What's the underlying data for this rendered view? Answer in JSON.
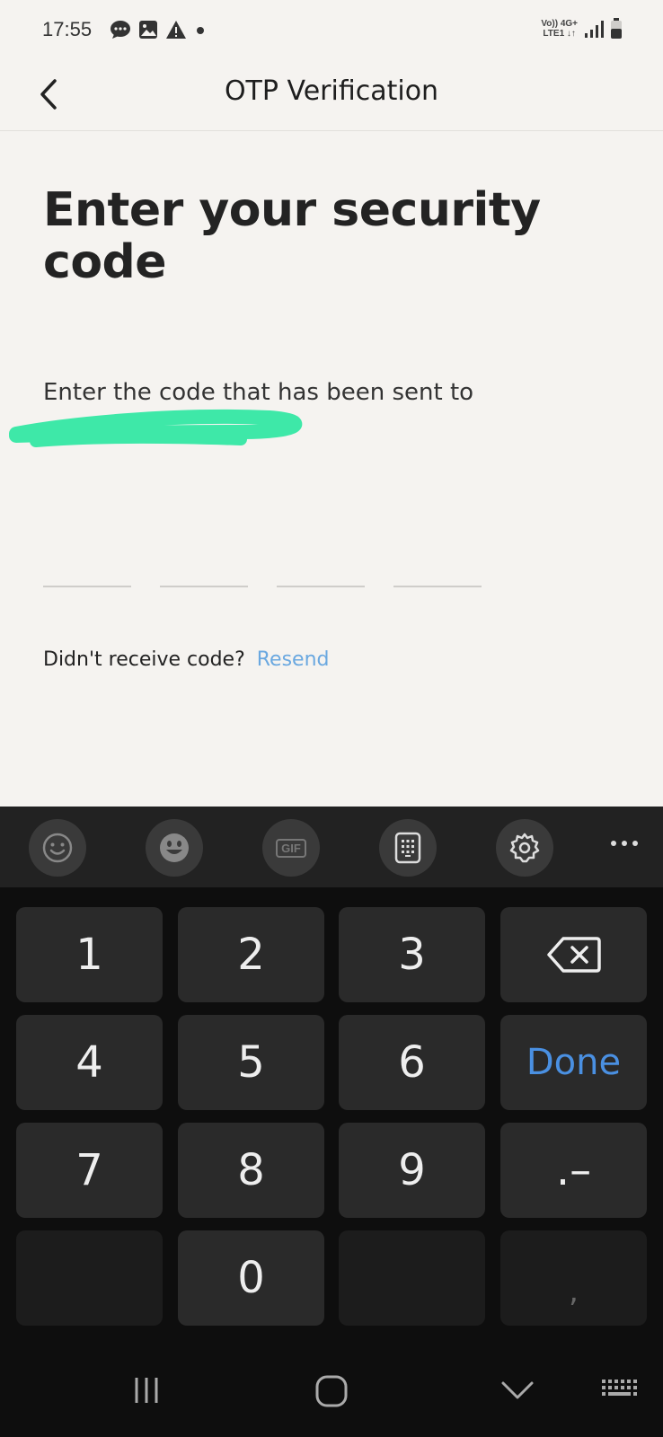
{
  "status_bar": {
    "time": "17:55",
    "network_label_top": "Vo)) 4G+",
    "network_label_bottom": "LTE1 ↓↑"
  },
  "header": {
    "title": "OTP Verification"
  },
  "main": {
    "title": "Enter your security code",
    "subtitle": "Enter the code that has been sent to",
    "otp_digits": [
      "",
      "",
      "",
      ""
    ],
    "resend_prompt": "Didn't receive code?",
    "resend_link": "Resend"
  },
  "keyboard": {
    "toolbar": [
      "emoji-icon",
      "sticker-icon",
      "gif-icon",
      "keypad-icon",
      "gear-icon",
      "more-icon"
    ],
    "gif_label": "GIF",
    "keys": {
      "k1": "1",
      "k2": "2",
      "k3": "3",
      "k4": "4",
      "k5": "5",
      "k6": "6",
      "k7": "7",
      "k8": "8",
      "k9": "9",
      "k0": "0",
      "done": "Done",
      "dot_dash": ".–",
      "comma": ","
    }
  },
  "colors": {
    "background": "#f5f3f0",
    "accent_link": "#6aa8e0",
    "done_key": "#4a90e2",
    "redaction": "#3ee8a8",
    "keyboard_bg": "#0e0e0e"
  }
}
